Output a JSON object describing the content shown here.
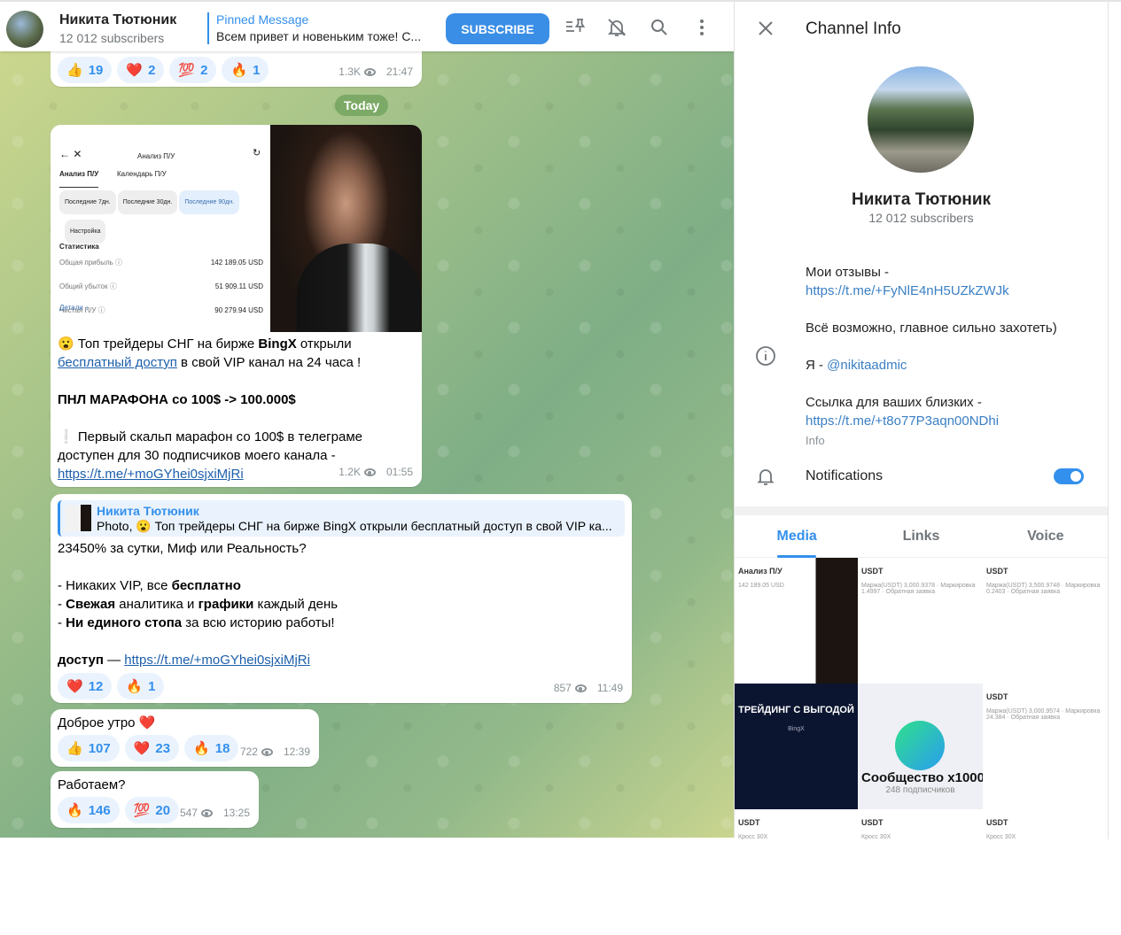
{
  "header": {
    "channel_name": "Никита Тютюник",
    "subscribers": "12 012 subscribers",
    "pinned_label": "Pinned Message",
    "pinned_text": "Всем привет и новеньким тоже! С...",
    "subscribe": "SUBSCRIBE"
  },
  "date_divider": "Today",
  "messages": [
    {
      "reactions": [
        {
          "emoji": "👍",
          "count": "19"
        },
        {
          "emoji": "❤️",
          "count": "2"
        },
        {
          "emoji": "💯",
          "count": "2"
        },
        {
          "emoji": "🔥",
          "count": "1"
        }
      ],
      "views": "1.3K",
      "time": "21:47"
    },
    {
      "stats": {
        "title": "Анализ П/У",
        "tab1": "Анализ П/У",
        "tab2": "Календарь П/У",
        "chips": [
          "Последние 7дн.",
          "Последние 30дн.",
          "Последние 90дн.",
          "Настройка"
        ],
        "section": "Статистика",
        "rows": [
          {
            "label": "Общая прибыль",
            "value": "142 189.05 USD"
          },
          {
            "label": "Общий убыток",
            "value": "51 909.11 USD"
          },
          {
            "label": "Чистая П/У",
            "value": "90 279.94 USD"
          }
        ],
        "details": "Детали ↓"
      },
      "l1a": "😮 Топ трейдеры СНГ на бирже ",
      "l1b": "BingX",
      "l1c": " открыли",
      "l2a": "бесплатный доступ",
      "l2b": " в свой VIP канал на 24 часа !",
      "l3": "ПНЛ МАРАФОНА со 100$ -> 100.000$",
      "l4": "❕ Первый скальп марафон со 100$ в телеграме",
      "l5": "доступен для 30 подписчиков моего канала -",
      "link": "https://t.me/+moGYhei0sjxiMjRi",
      "views": "1.2K",
      "time": "01:55"
    },
    {
      "reply_name": "Никита Тютюник",
      "reply_text": "Photo, 😮 Топ трейдеры СНГ на бирже BingX открыли бесплатный доступ в свой VIP ка...",
      "l1": "23450% за сутки, Миф или Реальность?",
      "l2a": "-  Никаких VIP,  все ",
      "l2b": "бесплатно",
      "l3a": "- ",
      "l3b": "Свежая",
      "l3c": " аналитика и ",
      "l3d": "графики",
      "l3e": " каждый день",
      "l4a": "- ",
      "l4b": "Ни единого стопа",
      "l4c": " за всю историю работы!",
      "l5a": "доступ",
      "l5b": " — ",
      "link": "https://t.me/+moGYhei0sjxiMjRi",
      "reactions": [
        {
          "emoji": "❤️",
          "count": "12"
        },
        {
          "emoji": "🔥",
          "count": "1"
        }
      ],
      "views": "857",
      "time": "11:49"
    },
    {
      "text": "Доброе утро ❤️",
      "reactions": [
        {
          "emoji": "👍",
          "count": "107"
        },
        {
          "emoji": "❤️",
          "count": "23"
        },
        {
          "emoji": "🔥",
          "count": "18"
        }
      ],
      "views": "722",
      "time": "12:39"
    },
    {
      "text": "Работаем?",
      "reactions": [
        {
          "emoji": "🔥",
          "count": "146"
        },
        {
          "emoji": "💯",
          "count": "20"
        }
      ],
      "views": "547",
      "time": "13:25"
    }
  ],
  "panel": {
    "title": "Channel Info",
    "name": "Никита Тютюник",
    "subscribers": "12 012 subscribers",
    "info": {
      "l1": "Мои отзывы -",
      "link1": "https://t.me/+FyNlE4nH5UZkZWJk",
      "l2": "Всё возможно, главное сильно захотеть)",
      "l3a": "Я - ",
      "mention": "@nikitaadmic",
      "l4": "Ссылка для ваших близких -",
      "link2": "https://t.me/+t8o77P3aqn00NDhi",
      "label": "Info"
    },
    "notifications": "Notifications",
    "notifications_on": true,
    "tabs": [
      "Media",
      "Links",
      "Voice"
    ],
    "media": [
      {
        "title": "Анализ П/У",
        "text": "142 189.05 USD"
      },
      {
        "title": "USDT",
        "text": "Маржа(USDT) 3,000.9378 · Маркировка 1.4997 · Обратная заявка"
      },
      {
        "title": "USDT",
        "text": "Маржа(USDT) 3,500.9748 · Маркировка 0.2403 · Обратная заявка"
      },
      {
        "title": "ТРЕЙДИНГ С ВЫГОДОЙ",
        "text": "BingX"
      },
      {
        "title": "Сообщество x1000",
        "text": "248 подписчиков"
      },
      {
        "title": "USDT",
        "text": "Маржа(USDT) 3,000.9574 · Маркировка 24.384 · Обратная заявка"
      },
      {
        "title": "USDT",
        "text": "Кросс 30X"
      },
      {
        "title": "USDT",
        "text": "Кросс 30X"
      },
      {
        "title": "USDT",
        "text": "Кросс 30X"
      }
    ]
  },
  "colors": {
    "accent": "#3390ec",
    "subscribe": "#3a8ee6",
    "link": "#1c5fab"
  }
}
